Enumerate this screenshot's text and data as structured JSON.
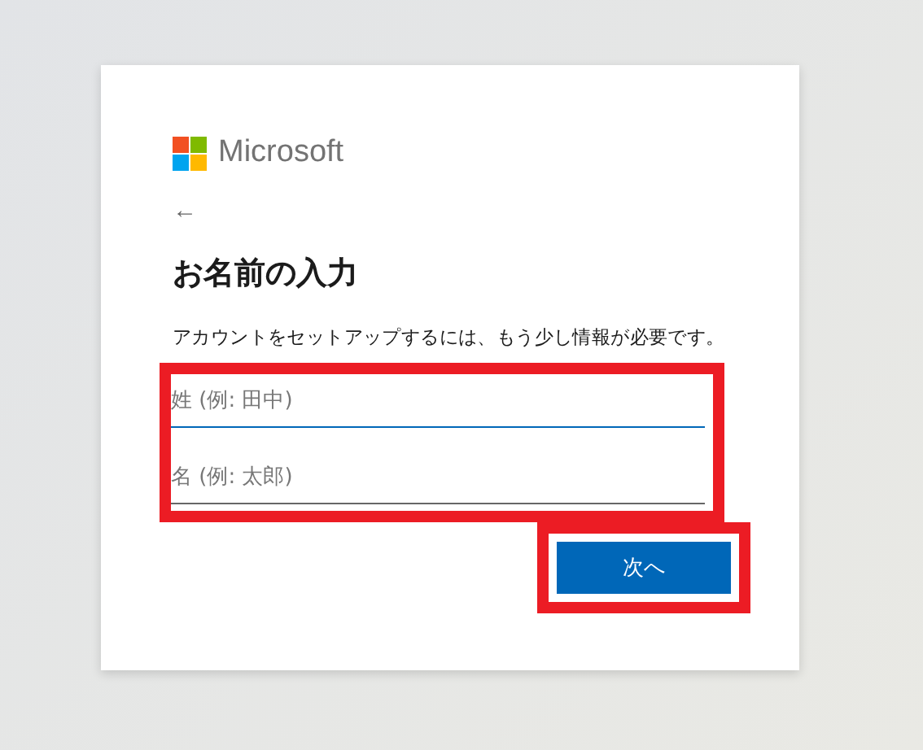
{
  "logo": {
    "text": "Microsoft"
  },
  "back": {
    "label": "←"
  },
  "title": "お名前の入力",
  "description": "アカウントをセットアップするには、もう少し情報が必要です。",
  "fields": [
    {
      "placeholder": "姓 (例: 田中)",
      "focused": true
    },
    {
      "placeholder": "名 (例: 太郎)",
      "focused": false
    }
  ],
  "buttons": [
    {
      "label": "次へ",
      "kind": "primary"
    }
  ]
}
